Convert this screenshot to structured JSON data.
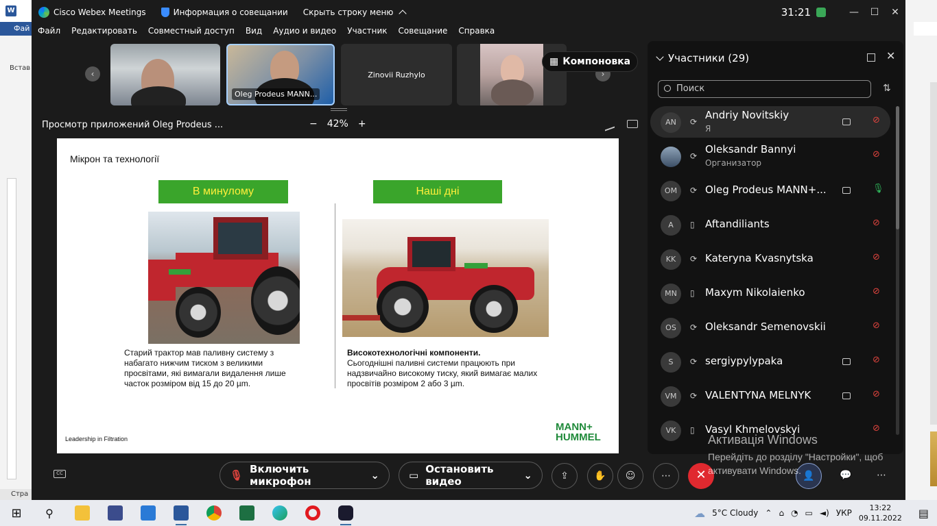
{
  "window": {
    "title": "Cisco Webex Meetings",
    "info_label": "Информация о совещании",
    "hide_bar_label": "Скрыть строку меню",
    "timer": "31:21"
  },
  "word": {
    "tab": "Фай",
    "paste": "Встав",
    "status": "Стра"
  },
  "menu": [
    "Файл",
    "Редактировать",
    "Совместный доступ",
    "Вид",
    "Аудио и видео",
    "Участник",
    "Совещание",
    "Справка"
  ],
  "videos": {
    "tile2_name": "Oleg Prodeus MANN...",
    "tile3_name": "Zinovii Ruzhylo",
    "layout_label": "Компоновка"
  },
  "share": {
    "title": "Просмотр приложений Oleg Prodeus ...",
    "zoom": "42%",
    "minus": "−",
    "plus": "+"
  },
  "slide": {
    "title": "Мікрон та технології",
    "label_past": "В минулому",
    "label_now": "Наші дні",
    "text_old": "Старий трактор мав паливну систему з набагато нижчим тиском з великими просвітами, які вимагали видалення лише часток розміром від 15 до 20 µm.",
    "text_new_bold": "Високотехнологічні компоненти.",
    "text_new": "Сьогоднішні паливні системи працюють при надзвичайно високому тиску, який вимагає малих просвітів розміром 2 або 3 µm.",
    "footer": "Leadership in Filtration",
    "brand_line1": "MANN+",
    "brand_line2": "HUMMEL"
  },
  "participants": {
    "header": "Участники (29)",
    "search_placeholder": "Поиск",
    "list": [
      {
        "initials": "AN",
        "name": "Andriy Novitskiy",
        "sub": "Я",
        "camera": true,
        "mic": "muted"
      },
      {
        "initials": "",
        "name": "Oleksandr Bannyi",
        "sub": "Организатор",
        "camera": false,
        "mic": "muted"
      },
      {
        "initials": "OM",
        "name": "Oleg Prodeus MANN+...",
        "sub": "",
        "camera": true,
        "mic": "on"
      },
      {
        "initials": "A",
        "name": "Aftandiliants",
        "sub": "",
        "camera": false,
        "mic": "muted"
      },
      {
        "initials": "KK",
        "name": "Kateryna Kvasnytska",
        "sub": "",
        "camera": false,
        "mic": "muted"
      },
      {
        "initials": "MN",
        "name": "Maxym Nikolaienko",
        "sub": "",
        "camera": false,
        "mic": "muted"
      },
      {
        "initials": "OS",
        "name": "Oleksandr Semenovskii",
        "sub": "",
        "camera": false,
        "mic": "muted"
      },
      {
        "initials": "S",
        "name": "sergiypylypaka",
        "sub": "",
        "camera": true,
        "mic": "muted"
      },
      {
        "initials": "VM",
        "name": "VALENTYNA MELNYK",
        "sub": "",
        "camera": true,
        "mic": "muted"
      },
      {
        "initials": "VK",
        "name": "Vasyl Khmelovskyi",
        "sub": "",
        "camera": false,
        "mic": "muted"
      }
    ]
  },
  "controls": {
    "mic_label": "Включить микрофон",
    "video_label": "Остановить видео",
    "cc": "CC"
  },
  "activation": {
    "line1": "Активація Windows",
    "line2": "Перейдіть до розділу \"Настройки\", щоб",
    "line3": "активувати Windows."
  },
  "taskbar": {
    "weather": "5°C  Cloudy",
    "lang": "УКР",
    "time": "13:22",
    "date": "09.11.2022"
  },
  "colors": {
    "slide_green": "#3aa52b",
    "slide_yellow": "#ffef3a",
    "end_red": "#e0292f",
    "mic_muted": "#e0443e",
    "mic_on": "#2fb55a"
  }
}
